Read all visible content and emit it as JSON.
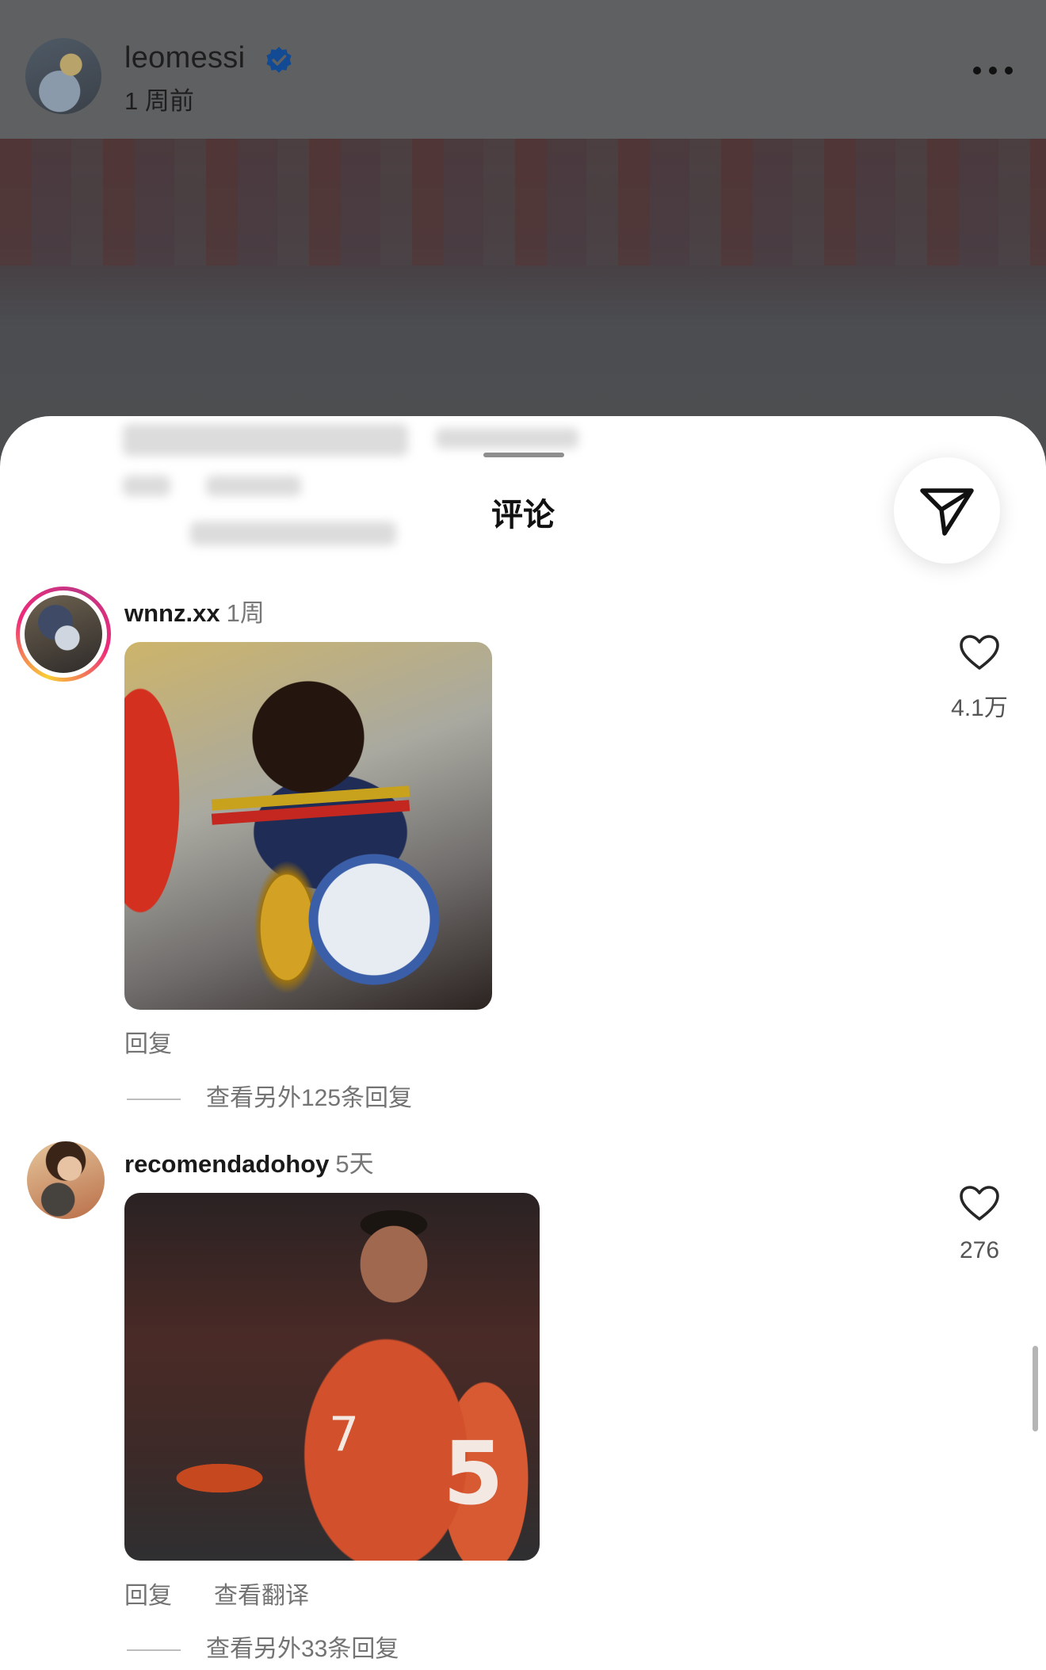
{
  "post": {
    "username": "leomessi",
    "time": "1 周前"
  },
  "sheet": {
    "title": "评论"
  },
  "comments": [
    {
      "username": "wnnz.xx",
      "time": "1周",
      "likes": "4.1万",
      "reply_label": "回复",
      "view_replies": "查看另外125条回复",
      "has_story_ring": true
    },
    {
      "username": "recomendadohoy",
      "time": "5天",
      "likes": "276",
      "reply_label": "回复",
      "translate_label": "查看翻译",
      "view_replies": "查看另外33条回复",
      "has_story_ring": false
    }
  ],
  "icons": {
    "verified": "verified-badge-icon",
    "more": "more-options-icon",
    "share": "paper-plane-icon",
    "like": "heart-icon"
  },
  "colors": {
    "verified_blue": "#1877f2",
    "story_ring_start": "#f9ce34",
    "story_ring_end": "#ee2a7b",
    "secondary_text": "#737373"
  }
}
